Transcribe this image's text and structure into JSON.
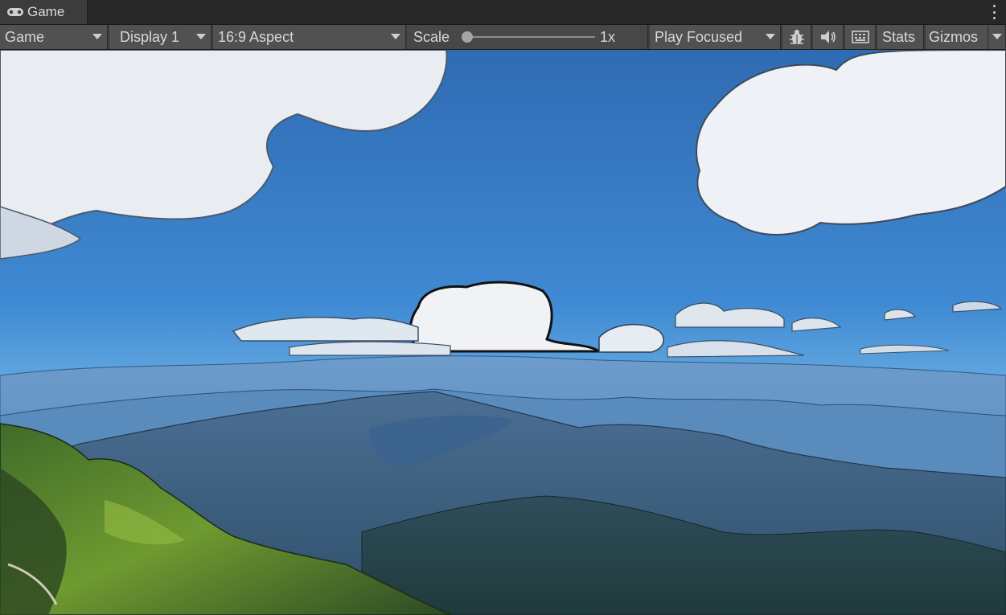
{
  "window": {
    "tab_label": "Game",
    "tab_icon": "gamepad-icon",
    "menu_icon": "kebab-menu-icon"
  },
  "toolbar": {
    "view_mode": "Game",
    "display": "Display 1",
    "aspect": "16:9 Aspect",
    "scale_label": "Scale",
    "scale_value": "1x",
    "play_mode": "Play Focused",
    "stats_label": "Stats",
    "gizmos_label": "Gizmos",
    "icons": [
      "bug-icon",
      "speaker-icon",
      "keyboard-icon",
      "dropdown-arrow-icon"
    ]
  },
  "colors": {
    "panel_bg": "#3c3c3c",
    "button_bg": "#515151",
    "sky": "#3a7fc8"
  }
}
